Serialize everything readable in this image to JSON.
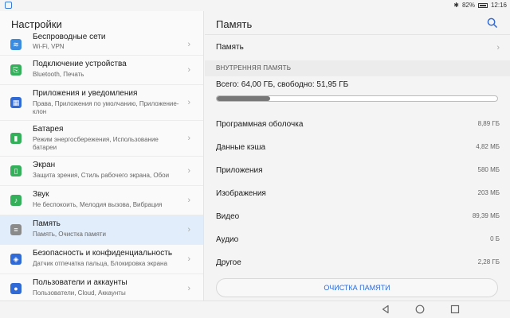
{
  "status": {
    "battery": "82%",
    "time": "12:16"
  },
  "left": {
    "title": "Настройки",
    "items": [
      {
        "title": "Беспроводные сети",
        "sub": "Wi-Fi, VPN",
        "color": "#3b8be0",
        "icon": "wifi-icon"
      },
      {
        "title": "Подключение устройства",
        "sub": "Bluetooth, Печать",
        "color": "#34b05a",
        "icon": "device-connection-icon"
      },
      {
        "title": "Приложения и уведомления",
        "sub": "Права, Приложения по умолчанию, Приложение-клон",
        "color": "#2f6ad6",
        "icon": "apps-icon"
      },
      {
        "title": "Батарея",
        "sub": "Режим энергосбережения, Использование батареи",
        "color": "#34b05a",
        "icon": "battery-icon"
      },
      {
        "title": "Экран",
        "sub": "Защита зрения, Стиль рабочего экрана, Обои",
        "color": "#34b05a",
        "icon": "display-icon"
      },
      {
        "title": "Звук",
        "sub": "Не беспокоить, Мелодия вызова, Вибрация",
        "color": "#34b05a",
        "icon": "sound-icon"
      },
      {
        "title": "Память",
        "sub": "Память, Очистка памяти",
        "color": "#8a8a8a",
        "icon": "storage-icon"
      },
      {
        "title": "Безопасность и конфиденциальность",
        "sub": "Датчик отпечатка пальца, Блокировка экрана",
        "color": "#2f6ad6",
        "icon": "shield-icon"
      },
      {
        "title": "Пользователи и аккаунты",
        "sub": "Пользователи, Cloud, Аккаунты",
        "color": "#2f6ad6",
        "icon": "user-icon"
      }
    ]
  },
  "right": {
    "title": "Память",
    "storage_link": "Память",
    "section": "ВНУТРЕННЯЯ ПАМЯТЬ",
    "total": "Всего: 64,00 ГБ, свободно: 51,95 ГБ",
    "used_fraction": 0.19,
    "rows": [
      {
        "label": "Программная оболочка",
        "value": "8,89 ГБ"
      },
      {
        "label": "Данные кэша",
        "value": "4,82 МБ"
      },
      {
        "label": "Приложения",
        "value": "580 МБ"
      },
      {
        "label": "Изображения",
        "value": "203 МБ"
      },
      {
        "label": "Видео",
        "value": "89,39 МБ"
      },
      {
        "label": "Аудио",
        "value": "0 Б"
      },
      {
        "label": "Другое",
        "value": "2,28 ГБ"
      }
    ],
    "clear_button": "ОЧИСТКА ПАМЯТИ"
  }
}
